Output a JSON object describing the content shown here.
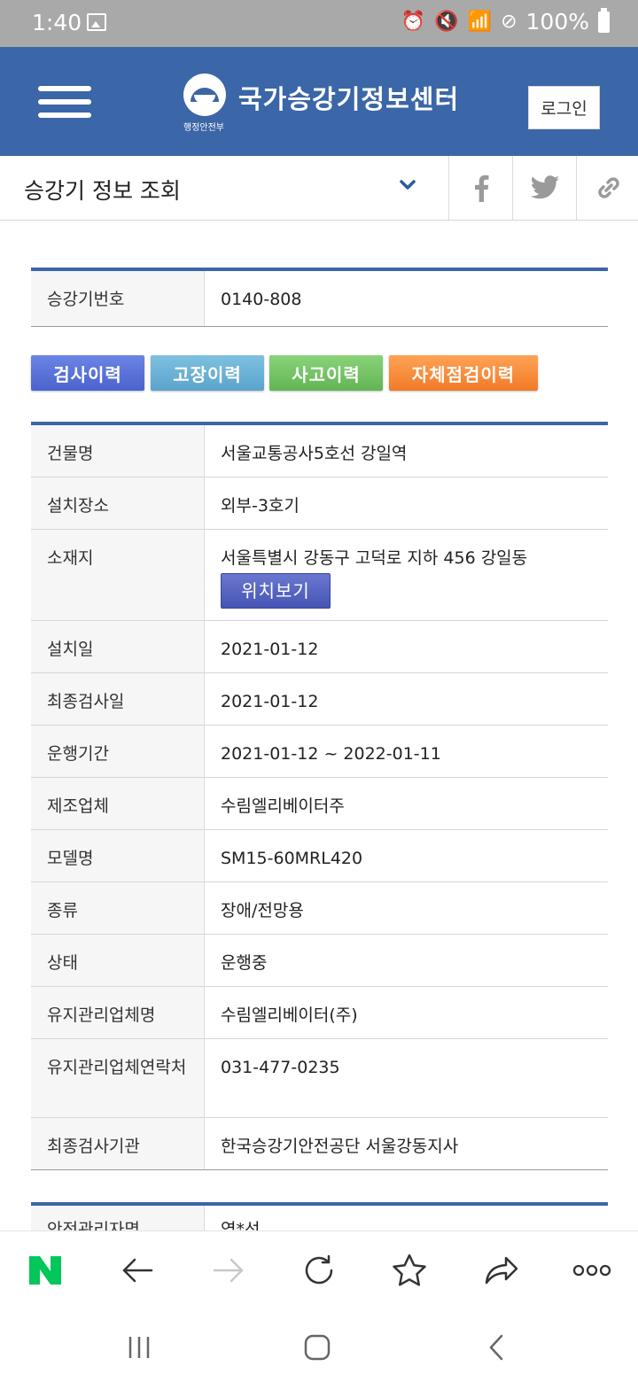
{
  "status_bar": {
    "time": "1:40",
    "battery": "100%"
  },
  "header": {
    "site_title": "국가승강기정보센터",
    "org_label": "행정안전부",
    "login_label": "로그인"
  },
  "title_bar": {
    "page_title": "승강기 정보 조회"
  },
  "elevator_number": {
    "label": "승강기번호",
    "value": "0140-808"
  },
  "tabs": [
    "검사이력",
    "고장이력",
    "사고이력",
    "자체점검이력"
  ],
  "details": [
    {
      "label": "건물명",
      "value": "서울교통공사5호선 강일역"
    },
    {
      "label": "설치장소",
      "value": "외부-3호기"
    },
    {
      "label": "소재지",
      "value": "서울특별시 강동구 고덕로 지하 456 강일동",
      "button": "위치보기"
    },
    {
      "label": "설치일",
      "value": "2021-01-12"
    },
    {
      "label": "최종검사일",
      "value": "2021-01-12"
    },
    {
      "label": "운행기간",
      "value": "2021-01-12 ~ 2022-01-11"
    },
    {
      "label": "제조업체",
      "value": "수림엘리베이터주"
    },
    {
      "label": "모델명",
      "value": "SM15-60MRL420"
    },
    {
      "label": "종류",
      "value": "장애/전망용"
    },
    {
      "label": "상태",
      "value": "운행중"
    },
    {
      "label": "유지관리업체명",
      "value": "수림엘리베이터(주)"
    },
    {
      "label": "유지관리업체연락처",
      "value": "031-477-0235"
    },
    {
      "label": "최종검사기관",
      "value": "한국승강기안전공단 서울강동지사"
    }
  ],
  "partial_row": {
    "label": "안전관리자명",
    "value": "염*선"
  },
  "colors": {
    "header": "#3b66a7",
    "naver_green": "#03c75a"
  }
}
